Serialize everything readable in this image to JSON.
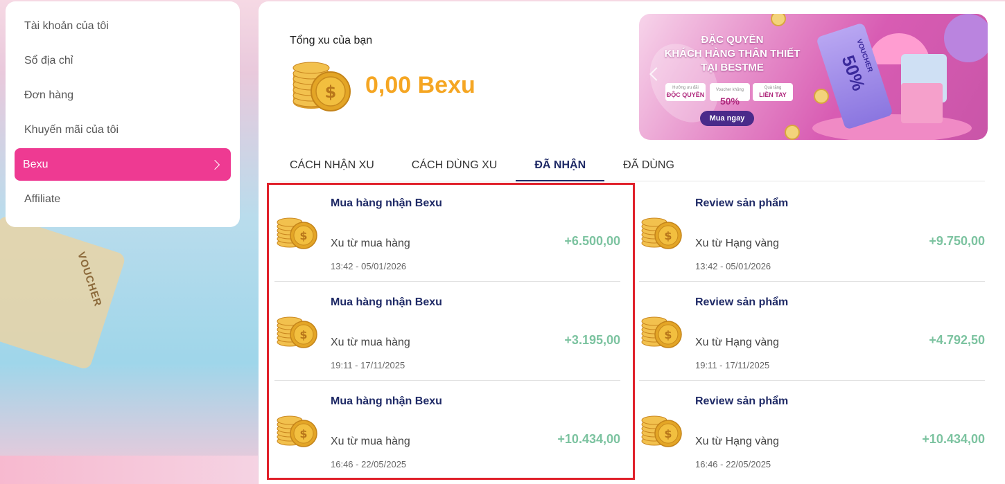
{
  "sidebar": {
    "items": [
      {
        "label": "Tài khoản của tôi"
      },
      {
        "label": "Sổ địa chỉ"
      },
      {
        "label": "Đơn hàng"
      },
      {
        "label": "Khuyến mãi của tôi"
      },
      {
        "label": "Bexu"
      },
      {
        "label": "Affiliate"
      }
    ],
    "active_index": 4
  },
  "background": {
    "voucher_text": "VOUCHER",
    "percent": "%"
  },
  "summary": {
    "label": "Tổng xu của bạn",
    "value": "0,00 Bexu",
    "coin_icon": "coin-stack-icon"
  },
  "banner": {
    "headline_line1": "ĐẶC QUYỀN",
    "headline_line2": "KHÁCH HÀNG THÂN THIẾT",
    "headline_line3": "TẠI BESTME",
    "badge1_small": "Hưởng ưu đãi",
    "badge1_main": "ĐỘC QUYỀN",
    "badge2_small": "Voucher khủng",
    "badge2_main": "50%",
    "badge3_small": "Quà tặng",
    "badge3_main": "LIỀN TAY",
    "buy_label": "Mua ngay",
    "voucher_label": "VOUCHER",
    "voucher_value": "50%"
  },
  "tabs": [
    {
      "label": "CÁCH NHẬN XU"
    },
    {
      "label": "CÁCH DÙNG XU"
    },
    {
      "label": "ĐÃ NHẬN"
    },
    {
      "label": "ĐÃ DÙNG"
    }
  ],
  "active_tab": 2,
  "history_left": [
    {
      "title": "Mua hàng nhận Bexu",
      "sub": "Xu từ mua hàng",
      "time": "13:42 - 05/01/2026",
      "amount": "+6.500,00"
    },
    {
      "title": "Mua hàng nhận Bexu",
      "sub": "Xu từ mua hàng",
      "time": "19:11 - 17/11/2025",
      "amount": "+3.195,00"
    },
    {
      "title": "Mua hàng nhận Bexu",
      "sub": "Xu từ mua hàng",
      "time": "16:46 - 22/05/2025",
      "amount": "+10.434,00"
    }
  ],
  "history_right": [
    {
      "title": "Review sản phẩm",
      "sub": "Xu từ Hạng vàng",
      "time": "13:42 - 05/01/2026",
      "amount": "+9.750,00"
    },
    {
      "title": "Review sản phẩm",
      "sub": "Xu từ Hạng vàng",
      "time": "19:11 - 17/11/2025",
      "amount": "+4.792,50"
    },
    {
      "title": "Review sản phẩm",
      "sub": "Xu từ Hạng vàng",
      "time": "16:46 - 22/05/2025",
      "amount": "+10.434,00"
    }
  ],
  "colors": {
    "accent_pink": "#ee3a92",
    "coin_value": "#f5a623",
    "amount_green": "#7cc3a0",
    "title_navy": "#1f2a66",
    "highlight_red": "#e0202a"
  }
}
